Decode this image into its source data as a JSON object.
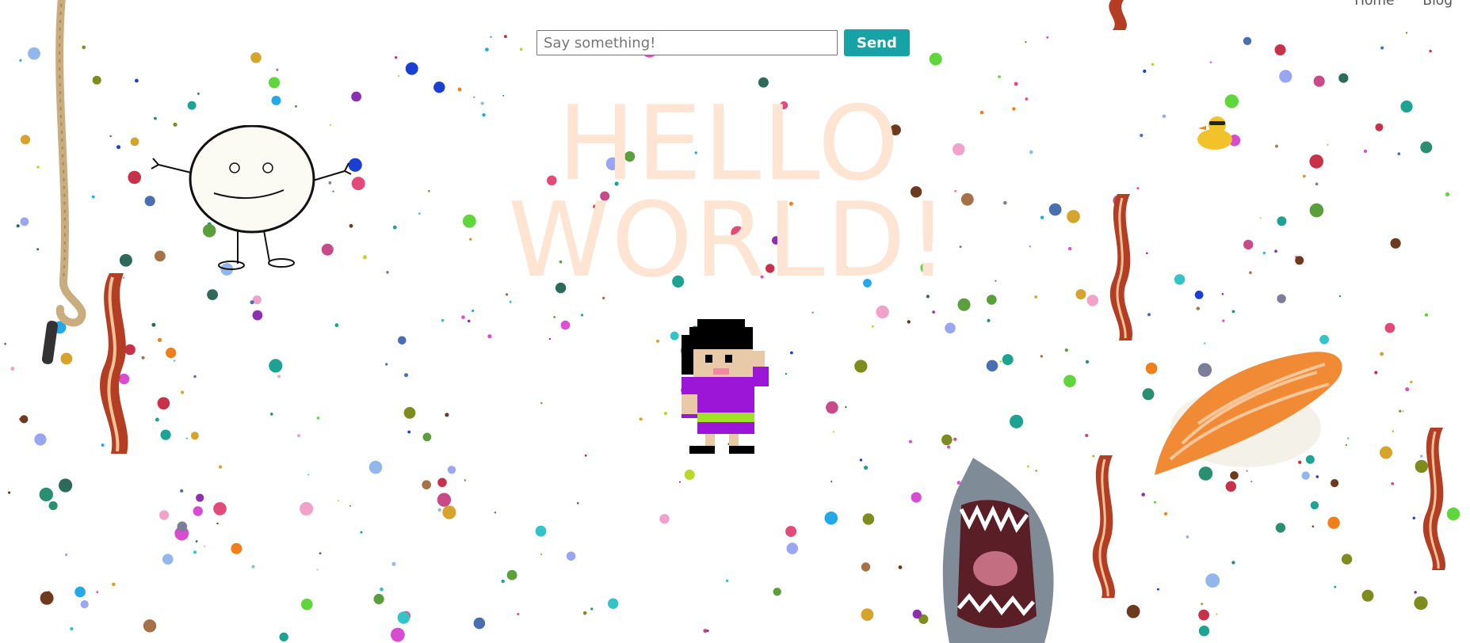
{
  "nav": {
    "home": "Home",
    "blog": "Blog"
  },
  "chat": {
    "placeholder": "Say something!",
    "send_label": "Send"
  },
  "hero": {
    "line1": "HELLO",
    "line2": "WORLD!"
  },
  "colors": {
    "accent": "#17a2a5",
    "hero_text": "#fde4d3",
    "dots": [
      "#35c3c8",
      "#2d6a5b",
      "#e24a7a",
      "#8c2fb0",
      "#1a3fd1",
      "#5fd63c",
      "#b9d92a",
      "#d6a32c",
      "#f07f1a",
      "#c7314a",
      "#7e8b1e",
      "#9aa7f0",
      "#e04fd3",
      "#2a8f70",
      "#a57147",
      "#23a8e8",
      "#6e3a1e",
      "#5b9e3c",
      "#d64dd2",
      "#1ea392",
      "#91b7ec",
      "#f0a2c8",
      "#4a6fb0",
      "#c64b88",
      "#7d7d9a"
    ]
  },
  "sprites": [
    "rope-icon",
    "bacon-icon",
    "stickman-icon",
    "duck-icon",
    "girl-icon",
    "sushi-icon",
    "shark-icon"
  ]
}
